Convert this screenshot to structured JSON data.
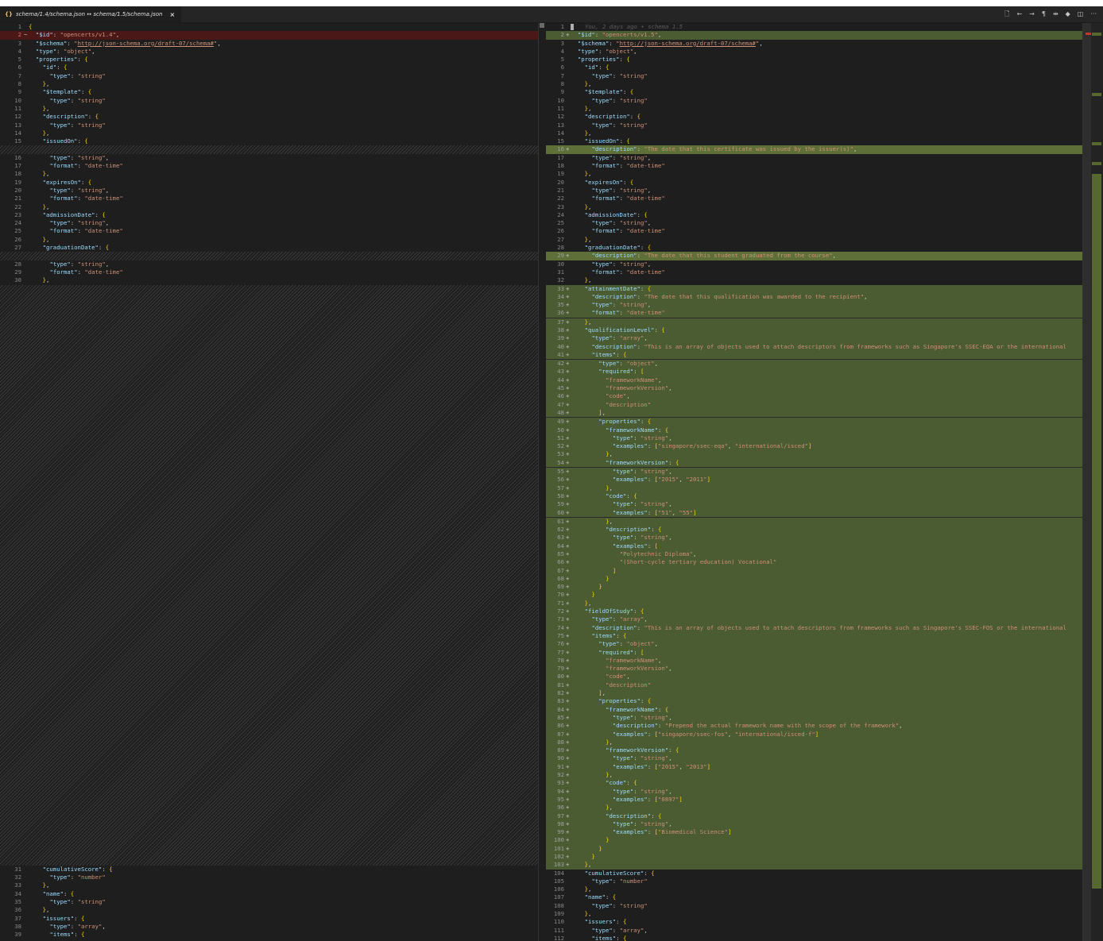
{
  "tab": {
    "icon": "{}",
    "title": "schema/1.4/schema.json ↔ schema/1.5/schema.json",
    "close": "×"
  },
  "toolbar": {
    "open_file": "🗋",
    "previous_change": "←",
    "next_change": "→",
    "whitespace": "¶",
    "inline_view": "⇹",
    "git_changes": "◆",
    "split_editor": "◫",
    "more": "···"
  },
  "blame_annotation": "You, 2 days ago • schema 1.5",
  "colors": {
    "editor_background": "#1e1e1e",
    "removed_line": "#4b1818",
    "inserted_line": "#4b5b32",
    "json_key": "#9cdcfe",
    "json_string": "#ce9178",
    "bracket": "#ffd700"
  },
  "left_lines": [
    [
      "row",
      "1",
      "",
      "{"
    ],
    [
      "del",
      "2",
      "−",
      "  \"$id\": \"opencerts/v1.4\","
    ],
    [
      "row",
      "3",
      "",
      "  \"$schema\": \"http://json-schema.org/draft-07/schema#\","
    ],
    [
      "row",
      "4",
      "",
      "  \"type\": \"object\","
    ],
    [
      "row",
      "5",
      "",
      "  \"properties\": {"
    ],
    [
      "row",
      "6",
      "",
      "    \"id\": {"
    ],
    [
      "row",
      "7",
      "",
      "      \"type\": \"string\""
    ],
    [
      "row",
      "8",
      "",
      "    },"
    ],
    [
      "row",
      "9",
      "",
      "    \"$template\": {"
    ],
    [
      "row",
      "10",
      "",
      "      \"type\": \"string\""
    ],
    [
      "row",
      "11",
      "",
      "    },"
    ],
    [
      "row",
      "12",
      "",
      "    \"description\": {"
    ],
    [
      "row",
      "13",
      "",
      "      \"type\": \"string\""
    ],
    [
      "row",
      "14",
      "",
      "    },"
    ],
    [
      "row",
      "15",
      "",
      "    \"issuedOn\": {"
    ],
    [
      "filler",
      "",
      "",
      ""
    ],
    [
      "row",
      "16",
      "",
      "      \"type\": \"string\","
    ],
    [
      "row",
      "17",
      "",
      "      \"format\": \"date-time\""
    ],
    [
      "row",
      "18",
      "",
      "    },"
    ],
    [
      "row",
      "19",
      "",
      "    \"expiresOn\": {"
    ],
    [
      "row",
      "20",
      "",
      "      \"type\": \"string\","
    ],
    [
      "row",
      "21",
      "",
      "      \"format\": \"date-time\""
    ],
    [
      "row",
      "22",
      "",
      "    },"
    ],
    [
      "row",
      "23",
      "",
      "    \"admissionDate\": {"
    ],
    [
      "row",
      "24",
      "",
      "      \"type\": \"string\","
    ],
    [
      "row",
      "25",
      "",
      "      \"format\": \"date-time\""
    ],
    [
      "row",
      "26",
      "",
      "    },"
    ],
    [
      "row",
      "27",
      "",
      "    \"graduationDate\": {"
    ],
    [
      "filler",
      "",
      "",
      ""
    ],
    [
      "row",
      "28",
      "",
      "      \"type\": \"string\","
    ],
    [
      "row",
      "29",
      "",
      "      \"format\": \"date-time\""
    ],
    [
      "row",
      "30",
      "",
      "    },"
    ],
    [
      "fillerblock",
      "",
      "",
      ""
    ],
    [
      "row",
      "31",
      "",
      "    \"cumulativeScore\": {"
    ],
    [
      "row",
      "32",
      "",
      "      \"type\": \"number\""
    ],
    [
      "row",
      "33",
      "",
      "    },"
    ],
    [
      "row",
      "34",
      "",
      "    \"name\": {"
    ],
    [
      "row",
      "35",
      "",
      "      \"type\": \"string\""
    ],
    [
      "row",
      "36",
      "",
      "    },"
    ],
    [
      "row",
      "37",
      "",
      "    \"issuers\": {"
    ],
    [
      "row",
      "38",
      "",
      "      \"type\": \"array\","
    ],
    [
      "row",
      "39",
      "",
      "      \"items\": {"
    ]
  ],
  "right_lines": [
    [
      "blame",
      "1",
      "",
      ""
    ],
    [
      "ins",
      "2",
      "+",
      "  \"$id\": \"opencerts/v1.5\","
    ],
    [
      "row",
      "3",
      "",
      "  \"$schema\": \"http://json-schema.org/draft-07/schema#\","
    ],
    [
      "row",
      "4",
      "",
      "  \"type\": \"object\","
    ],
    [
      "row",
      "5",
      "",
      "  \"properties\": {"
    ],
    [
      "row",
      "6",
      "",
      "    \"id\": {"
    ],
    [
      "row",
      "7",
      "",
      "      \"type\": \"string\""
    ],
    [
      "row",
      "8",
      "",
      "    },"
    ],
    [
      "row",
      "9",
      "",
      "    \"$template\": {"
    ],
    [
      "row",
      "10",
      "",
      "      \"type\": \"string\""
    ],
    [
      "row",
      "11",
      "",
      "    },"
    ],
    [
      "row",
      "12",
      "",
      "    \"description\": {"
    ],
    [
      "row",
      "13",
      "",
      "      \"type\": \"string\""
    ],
    [
      "row",
      "14",
      "",
      "    },"
    ],
    [
      "row",
      "15",
      "",
      "    \"issuedOn\": {"
    ],
    [
      "ins hl",
      "16",
      "+",
      "      \"description\": \"The date that this certificate was issued by the issuer(s)\","
    ],
    [
      "row",
      "17",
      "",
      "      \"type\": \"string\","
    ],
    [
      "row",
      "18",
      "",
      "      \"format\": \"date-time\""
    ],
    [
      "row",
      "19",
      "",
      "    },"
    ],
    [
      "row",
      "20",
      "",
      "    \"expiresOn\": {"
    ],
    [
      "row",
      "21",
      "",
      "      \"type\": \"string\","
    ],
    [
      "row",
      "22",
      "",
      "      \"format\": \"date-time\""
    ],
    [
      "row",
      "23",
      "",
      "    },"
    ],
    [
      "row",
      "24",
      "",
      "    \"admissionDate\": {"
    ],
    [
      "row",
      "25",
      "",
      "      \"type\": \"string\","
    ],
    [
      "row",
      "26",
      "",
      "      \"format\": \"date-time\""
    ],
    [
      "row",
      "27",
      "",
      "    },"
    ],
    [
      "row",
      "28",
      "",
      "    \"graduationDate\": {"
    ],
    [
      "ins hl",
      "29",
      "+",
      "      \"description\": \"The date that this student graduated from the course\","
    ],
    [
      "row",
      "30",
      "",
      "      \"type\": \"string\","
    ],
    [
      "row",
      "31",
      "",
      "      \"format\": \"date-time\""
    ],
    [
      "row",
      "32",
      "",
      "    },"
    ],
    [
      "ins",
      "33",
      "+",
      "    \"attainmentDate\": {"
    ],
    [
      "ins",
      "34",
      "+",
      "      \"description\": \"The date that this qualification was awarded to the recipient\","
    ],
    [
      "ins",
      "35",
      "+",
      "      \"type\": \"string\","
    ],
    [
      "ins sep",
      "36",
      "+",
      "      \"format\": \"date-time\""
    ],
    [
      "ins",
      "37",
      "+",
      "    },"
    ],
    [
      "ins",
      "38",
      "+",
      "    \"qualificationLevel\": {"
    ],
    [
      "ins",
      "39",
      "+",
      "      \"type\": \"array\","
    ],
    [
      "ins",
      "40",
      "+",
      "      \"description\": \"This is an array of objects used to attach descriptors from frameworks such as Singapore's SSEC-EQA or the international"
    ],
    [
      "ins sep",
      "41",
      "+",
      "      \"items\": {"
    ],
    [
      "ins",
      "42",
      "+",
      "        \"type\": \"object\","
    ],
    [
      "ins",
      "43",
      "+",
      "        \"required\": ["
    ],
    [
      "ins",
      "44",
      "+",
      "          \"frameworkName\","
    ],
    [
      "ins",
      "45",
      "+",
      "          \"frameworkVersion\","
    ],
    [
      "ins",
      "46",
      "+",
      "          \"code\","
    ],
    [
      "ins",
      "47",
      "+",
      "          \"description\""
    ],
    [
      "ins sep",
      "48",
      "+",
      "        ],"
    ],
    [
      "ins",
      "49",
      "+",
      "        \"properties\": {"
    ],
    [
      "ins",
      "50",
      "+",
      "          \"frameworkName\": {"
    ],
    [
      "ins",
      "51",
      "+",
      "            \"type\": \"string\","
    ],
    [
      "ins",
      "52",
      "+",
      "            \"examples\": [\"singapore/ssec-eqa\", \"international/isced\"]"
    ],
    [
      "ins",
      "53",
      "+",
      "          },"
    ],
    [
      "ins sep",
      "54",
      "+",
      "          \"frameworkVersion\": {"
    ],
    [
      "ins",
      "55",
      "+",
      "            \"type\": \"string\","
    ],
    [
      "ins",
      "56",
      "+",
      "            \"examples\": [\"2015\", \"2011\"]"
    ],
    [
      "ins",
      "57",
      "+",
      "          },"
    ],
    [
      "ins",
      "58",
      "+",
      "          \"code\": {"
    ],
    [
      "ins",
      "59",
      "+",
      "            \"type\": \"string\","
    ],
    [
      "ins sep",
      "60",
      "+",
      "            \"examples\": [\"51\", \"55\"]"
    ],
    [
      "ins",
      "61",
      "+",
      "          },"
    ],
    [
      "ins",
      "62",
      "+",
      "          \"description\": {"
    ],
    [
      "ins",
      "63",
      "+",
      "            \"type\": \"string\","
    ],
    [
      "ins",
      "64",
      "+",
      "            \"examples\": ["
    ],
    [
      "ins",
      "65",
      "+",
      "              \"Polytechnic Diploma\","
    ],
    [
      "ins",
      "66",
      "+",
      "              \"(Short-cycle tertiary education) Vocational\""
    ],
    [
      "ins",
      "67",
      "+",
      "            ]"
    ],
    [
      "ins",
      "68",
      "+",
      "          }"
    ],
    [
      "ins",
      "69",
      "+",
      "        }"
    ],
    [
      "ins",
      "70",
      "+",
      "      }"
    ],
    [
      "ins",
      "71",
      "+",
      "    },"
    ],
    [
      "ins",
      "72",
      "+",
      "    \"fieldOfStudy\": {"
    ],
    [
      "ins",
      "73",
      "+",
      "      \"type\": \"array\","
    ],
    [
      "ins",
      "74",
      "+",
      "      \"description\": \"This is an array of objects used to attach descriptors from frameworks such as Singapore's SSEC-FOS or the international"
    ],
    [
      "ins",
      "75",
      "+",
      "      \"items\": {"
    ],
    [
      "ins",
      "76",
      "+",
      "        \"type\": \"object\","
    ],
    [
      "ins",
      "77",
      "+",
      "        \"required\": ["
    ],
    [
      "ins",
      "78",
      "+",
      "          \"frameworkName\","
    ],
    [
      "ins",
      "79",
      "+",
      "          \"frameworkVersion\","
    ],
    [
      "ins",
      "80",
      "+",
      "          \"code\","
    ],
    [
      "ins",
      "81",
      "+",
      "          \"description\""
    ],
    [
      "ins",
      "82",
      "+",
      "        ],"
    ],
    [
      "ins",
      "83",
      "+",
      "        \"properties\": {"
    ],
    [
      "ins",
      "84",
      "+",
      "          \"frameworkName\": {"
    ],
    [
      "ins",
      "85",
      "+",
      "            \"type\": \"string\","
    ],
    [
      "ins",
      "86",
      "+",
      "            \"description\": \"Prepend the actual framework name with the scope of the framework\","
    ],
    [
      "ins",
      "87",
      "+",
      "            \"examples\": [\"singapore/ssec-fos\", \"international/isced-f\"]"
    ],
    [
      "ins",
      "88",
      "+",
      "          },"
    ],
    [
      "ins",
      "89",
      "+",
      "          \"frameworkVersion\": {"
    ],
    [
      "ins",
      "90",
      "+",
      "            \"type\": \"string\","
    ],
    [
      "ins",
      "91",
      "+",
      "            \"examples\": [\"2015\", \"2013\"]"
    ],
    [
      "ins",
      "92",
      "+",
      "          },"
    ],
    [
      "ins",
      "93",
      "+",
      "          \"code\": {"
    ],
    [
      "ins",
      "94",
      "+",
      "            \"type\": \"string\","
    ],
    [
      "ins",
      "95",
      "+",
      "            \"examples\": [\"0897\"]"
    ],
    [
      "ins",
      "96",
      "+",
      "          },"
    ],
    [
      "ins",
      "97",
      "+",
      "          \"description\": {"
    ],
    [
      "ins",
      "98",
      "+",
      "            \"type\": \"string\","
    ],
    [
      "ins",
      "99",
      "+",
      "            \"examples\": [\"Biomedical Science\"]"
    ],
    [
      "ins",
      "100",
      "+",
      "          }"
    ],
    [
      "ins",
      "101",
      "+",
      "        }"
    ],
    [
      "ins",
      "102",
      "+",
      "      }"
    ],
    [
      "ins",
      "103",
      "+",
      "    },"
    ],
    [
      "row",
      "104",
      "",
      "    \"cumulativeScore\": {"
    ],
    [
      "row",
      "105",
      "",
      "      \"type\": \"number\""
    ],
    [
      "row",
      "106",
      "",
      "    },"
    ],
    [
      "row",
      "107",
      "",
      "    \"name\": {"
    ],
    [
      "row",
      "108",
      "",
      "      \"type\": \"string\""
    ],
    [
      "row",
      "109",
      "",
      "    },"
    ],
    [
      "row",
      "110",
      "",
      "    \"issuers\": {"
    ],
    [
      "row",
      "111",
      "",
      "      \"type\": \"array\","
    ],
    [
      "row",
      "112",
      "",
      "      \"items\": {"
    ]
  ]
}
